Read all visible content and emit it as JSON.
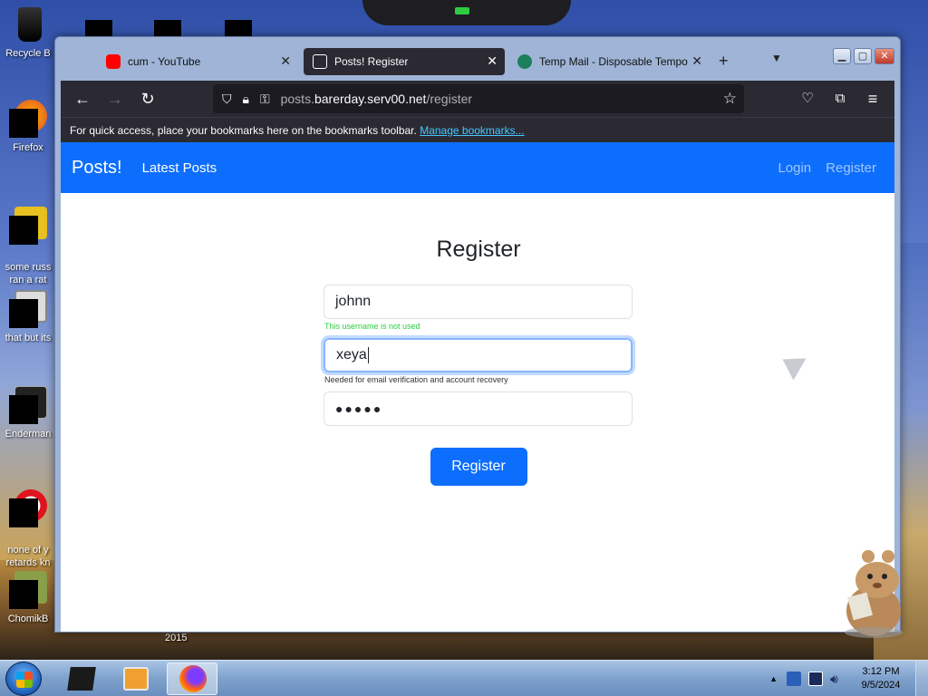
{
  "desktop": {
    "icons": [
      {
        "label": "Recycle B",
        "name": "recycle-bin-icon"
      },
      {
        "label": "Firefox",
        "name": "firefox-desktop-icon"
      },
      {
        "label": "some russ\nran a rat",
        "name": "desktop-shortcut-icon"
      },
      {
        "label": "that but its",
        "name": "desktop-shortcut-icon"
      },
      {
        "label": "Enderman",
        "name": "desktop-shortcut-icon"
      },
      {
        "label": "none of y\nretards kn",
        "name": "opera-desktop-icon"
      },
      {
        "label": "ChomikB",
        "name": "desktop-shortcut-icon"
      }
    ],
    "year_label": "2015"
  },
  "browser": {
    "tabs": [
      {
        "title": "cum - YouTube",
        "favicon": "youtube-icon",
        "color": "#ff0000"
      },
      {
        "title": "Posts! Register",
        "favicon": "page-icon",
        "color": "#fbfbfe"
      },
      {
        "title": "Temp Mail - Disposable Tempo",
        "favicon": "tempmail-icon",
        "color": "#1a7f5a"
      }
    ],
    "new_tab": "+",
    "url_host_prefix": "posts.",
    "url_host": "barerday.serv00.net",
    "url_path": "/register",
    "bookmarks_text": "For quick access, place your bookmarks here on the bookmarks toolbar.",
    "bookmarks_link": "Manage bookmarks..."
  },
  "site": {
    "brand": "Posts!",
    "nav_latest": "Latest Posts",
    "nav_login": "Login",
    "nav_register": "Register",
    "title": "Register",
    "username_value": "johnn",
    "username_hint": "This username is not used",
    "email_value": "xeya",
    "email_hint": "Needed for email verification and account recovery",
    "password_value": "●●●●●",
    "submit_label": "Register"
  },
  "taskbar": {
    "time": "3:12 PM",
    "date": "9/5/2024"
  },
  "colors": {
    "accent": "#0d6efd",
    "valid": "#2ecc40",
    "browser_chrome": "#2b2a33"
  }
}
